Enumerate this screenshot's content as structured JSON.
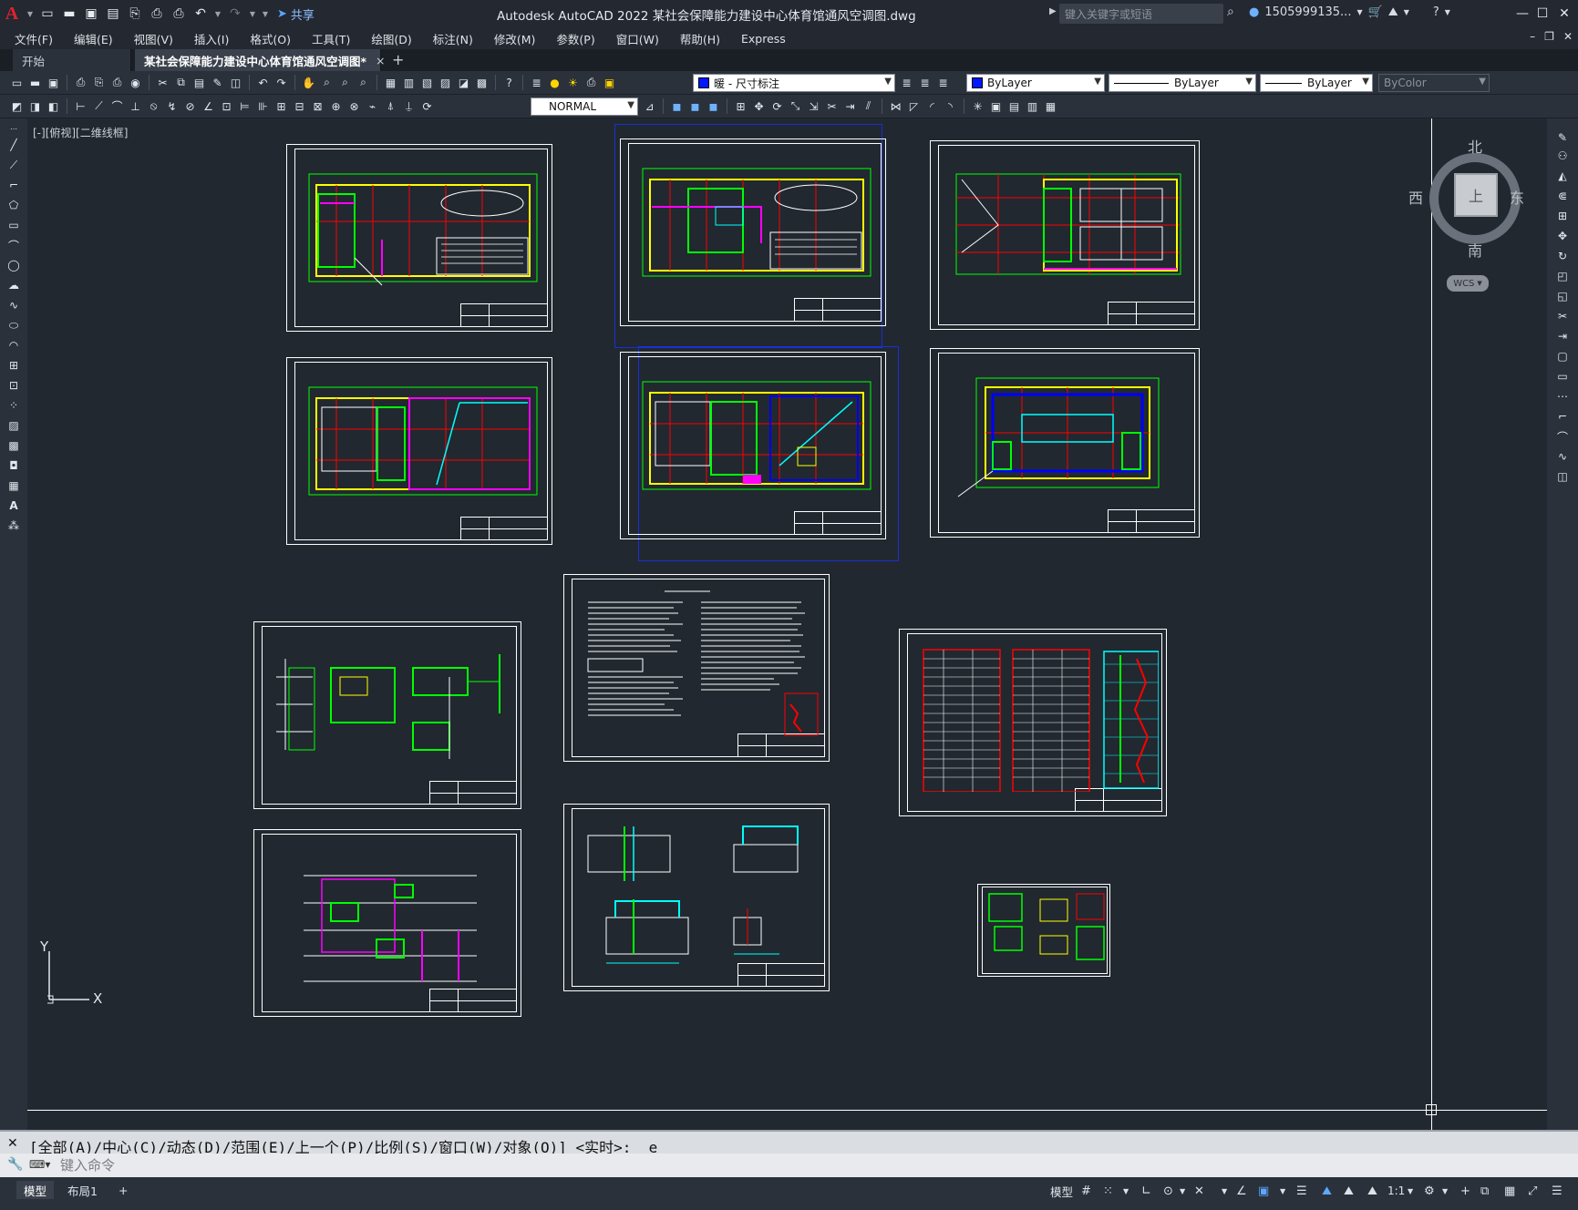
{
  "app": {
    "logo": "A",
    "title": "Autodesk AutoCAD 2022    某社会保障能力建设中心体育馆通风空调图.dwg",
    "share_label": "共享",
    "search_placeholder": "键入关键字或短语",
    "user": "1505999135...",
    "window_controls": {
      "minimize": "—",
      "maximize": "☐",
      "close": "✕"
    }
  },
  "menu": {
    "items": [
      "文件(F)",
      "编辑(E)",
      "视图(V)",
      "插入(I)",
      "格式(O)",
      "工具(T)",
      "绘图(D)",
      "标注(N)",
      "修改(M)",
      "参数(P)",
      "窗口(W)",
      "帮助(H)",
      "Express"
    ]
  },
  "tabs": {
    "start": "开始",
    "active_file": "某社会保障能力建设中心体育馆通风空调图*",
    "close": "×",
    "add": "+"
  },
  "toolbar": {
    "layer_name": "暖 - 尺寸标注",
    "color": "ByLayer",
    "linetype": "ByLayer",
    "lineweight": "ByLayer",
    "plotstyle": "ByColor",
    "dimstyle": "NORMAL"
  },
  "canvas": {
    "viewport_label": "[-][俯视][二维线框]",
    "ucs_y": "Y",
    "ucs_x": "X"
  },
  "viewcube": {
    "north": "北",
    "south": "南",
    "east": "东",
    "west": "西",
    "face": "上",
    "wcs": "WCS"
  },
  "command": {
    "history": "[全部(A)/中心(C)/动态(D)/范围(E)/上一个(P)/比例(S)/窗口(W)/对象(O)] <实时>: _e",
    "placeholder": "键入命令"
  },
  "status": {
    "model_tab": "模型",
    "layout_tab": "布局1",
    "add": "+",
    "model_button": "模型",
    "scale": "1:1"
  },
  "colors": {
    "canvas_bg": "#212830",
    "ui_bg": "#2b313b",
    "selection_blue": "#1b2fd6",
    "cad_green": "#00ff00",
    "cad_yellow": "#ffff00",
    "cad_red": "#ff0000",
    "cad_magenta": "#ff00ff",
    "cad_cyan": "#00ffff"
  }
}
